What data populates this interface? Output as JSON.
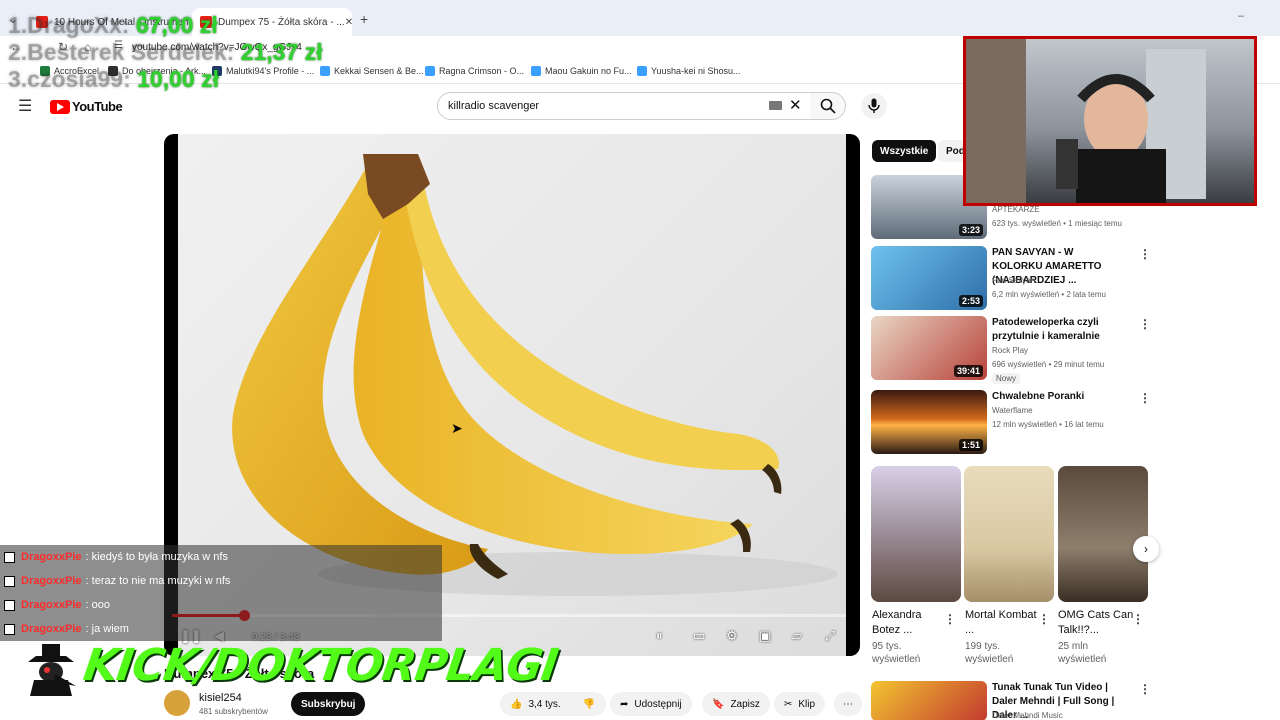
{
  "browser": {
    "tabs": [
      {
        "label": "10 Hours Of Metal - Instrument..."
      },
      {
        "label": "Dumpex 75 - Żółta skóra - ..."
      }
    ],
    "url": "youtube.com/watch?v=JGwQx_gGJs4",
    "bookmarks": [
      "AccroExcel",
      "Do obejrzenia - Ark...",
      "Malutki94's Profile - ...",
      "Kekkai Sensen & Be...",
      "Ragna Crimson - O...",
      "Maou Gakuin no Fu...",
      "Yuusha-kei ni Shosu..."
    ]
  },
  "youtube": {
    "logo": "YouTube",
    "search": {
      "value": "killradio scavenger"
    }
  },
  "player": {
    "time": "0:23 / 3:43",
    "progress_fraction": 0.107
  },
  "below": {
    "title": "Dumpex 75 - Żółta skóra",
    "channel": "kisiel254",
    "subs": "481 subskrybentów",
    "subscribe": "Subskrybuj",
    "likes": "3,4 tys.",
    "share": "Udostępnij",
    "save": "Zapisz",
    "clip": "Klip"
  },
  "sidebar": {
    "chips": [
      "Wszystkie",
      "Pod"
    ],
    "videos": [
      {
        "duration": "3:23",
        "title": "",
        "channel": "APTEKARZE",
        "meta": "623 tys. wyświetleń • 1 miesiąc temu",
        "thumb_color": "#7b8794"
      },
      {
        "duration": "2:53",
        "title": "PAN SAVYAN - W KOLORKU AMARETTO (NAJBARDZIEJ ...",
        "channel": "Pan Savyan",
        "meta": "6,2 mln wyświetleń • 2 lata temu",
        "thumb_color": "#4aa3d8"
      },
      {
        "duration": "39:41",
        "title": "Patodeweloperka czyli przytulnie i kameralnie",
        "channel": "Rock Play",
        "meta": "696 wyświetleń • 29 minut temu",
        "badge": "Nowy",
        "thumb_color": "#b7423a"
      },
      {
        "duration": "1:51",
        "title": "Chwalebne Poranki",
        "channel": "Waterflame",
        "meta": "12 mln wyświetleń • 16 lat temu",
        "thumb_color": "#d2691e"
      }
    ],
    "shorts": [
      {
        "title": "Alexandra Botez ...",
        "views": "95 tys. wyświetleń",
        "color": "#8f7f86"
      },
      {
        "title": "Mortal Kombat ...",
        "views": "199 tys. wyświetleń",
        "color": "#d9c9a3"
      },
      {
        "title": "OMG Cats Can Talk!!?...",
        "views": "25 mln wyświetleń",
        "color": "#8e7e6c"
      }
    ],
    "last": {
      "title": "Tunak Tunak Tun Video | Daler Mehndi | Full Song | Daler ...",
      "channel": "Daler Mehndi Music"
    }
  },
  "overlay": {
    "donations": [
      {
        "name": "1.DragoXx:",
        "amount": "67,00 zł"
      },
      {
        "name": "2.Besterek Serdelek:",
        "amount": "21,37 zł"
      },
      {
        "name": "3.czosia99:",
        "amount": "10,00 zł"
      }
    ],
    "chat": [
      {
        "user": "DragoxxPie",
        "msg": ": kiedyś to była muzyka w nfs"
      },
      {
        "user": "DragoxxPie",
        "msg": ": teraz to nie ma muzyki w nfs"
      },
      {
        "user": "DragoxxPie",
        "msg": ": ooo"
      },
      {
        "user": "DragoxxPie",
        "msg": ": ja wiem"
      }
    ],
    "kick": "KICK/DOKTORPLAGI"
  },
  "colors": {
    "yt_red": "#ff0000",
    "kick_green": "#53fc18",
    "chat_name": "#ff2b2b"
  }
}
